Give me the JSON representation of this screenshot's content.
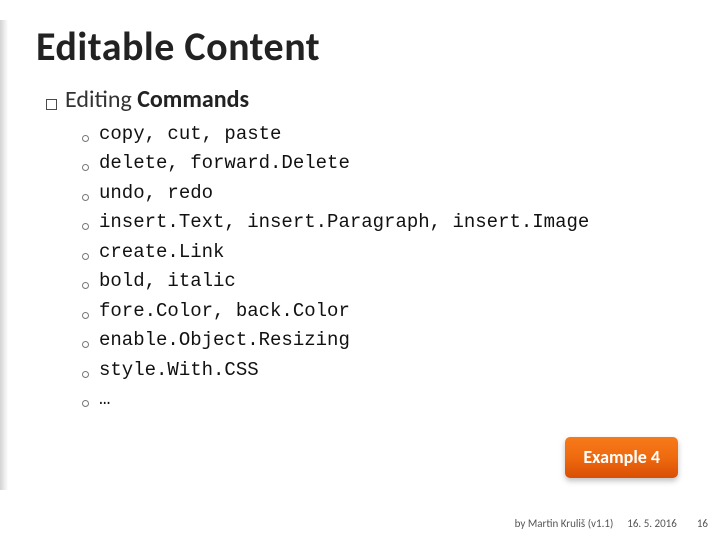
{
  "title": "Editable Content",
  "section": {
    "prefix": "Editing",
    "suffix": " Commands"
  },
  "commands": [
    "copy, cut, paste",
    "delete, forward.Delete",
    "undo, redo",
    "insert.Text, insert.Paragraph, insert.Image",
    "create.Link",
    "bold, italic",
    "fore.Color, back.Color",
    "enable.Object.Resizing",
    "style.With.CSS",
    "…"
  ],
  "badge": "Example 4",
  "footer": {
    "author": "by Martin Kruliš (v1.1)",
    "date": "16. 5. 2016",
    "page": "16"
  }
}
